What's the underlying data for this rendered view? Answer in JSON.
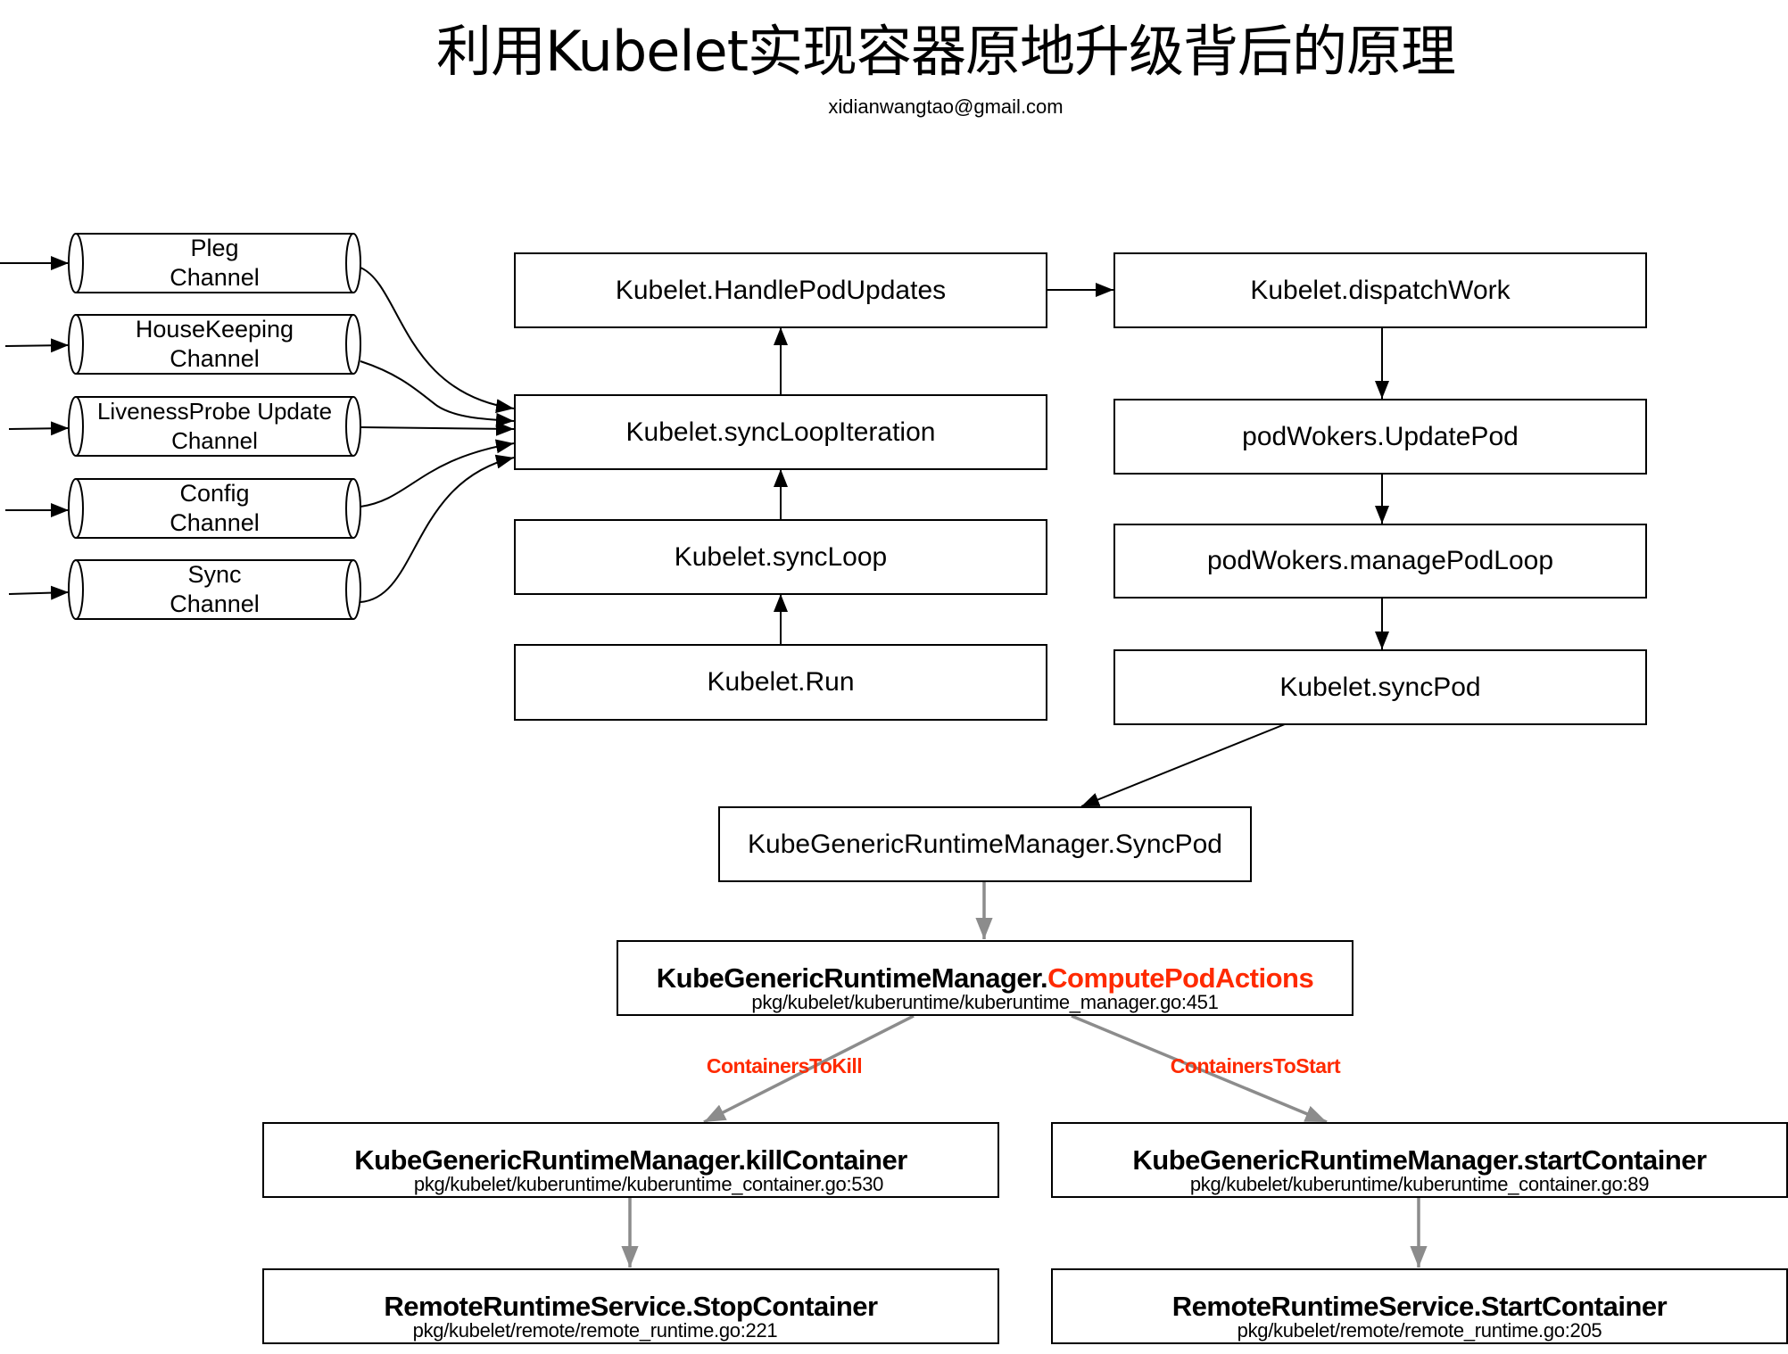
{
  "header": {
    "title": "利用Kubelet实现容器原地升级背后的原理",
    "author": "xidianwangtao@gmail.com"
  },
  "channels": [
    {
      "line1": "Pleg",
      "line2": "Channel"
    },
    {
      "line1": "HouseKeeping",
      "line2": "Channel"
    },
    {
      "line1": "LivenessProbe Update",
      "line2": "Channel"
    },
    {
      "line1": "Config",
      "line2": "Channel"
    },
    {
      "line1": "Sync",
      "line2": "Channel"
    }
  ],
  "kubelet_loop": {
    "handle_pod_updates": "Kubelet.HandlePodUpdates",
    "sync_loop_iteration": "Kubelet.syncLoopIteration",
    "sync_loop": "Kubelet.syncLoop",
    "run": "Kubelet.Run"
  },
  "pod_workers": {
    "dispatch_work": "Kubelet.dispatchWork",
    "update_pod": "podWokers.UpdatePod",
    "manage_pod_loop": "podWokers.managePodLoop",
    "sync_pod": "Kubelet.syncPod"
  },
  "runtime": {
    "sync_pod": "KubeGenericRuntimeManager.SyncPod",
    "compute_prefix": "KubeGenericRuntimeManager.",
    "compute_method": "ComputePodActions",
    "compute_path": "pkg/kubelet/kuberuntime/kuberuntime_manager.go:451",
    "kill_label": "ContainersToKill",
    "start_label": "ContainersToStart",
    "kill_container": "KubeGenericRuntimeManager.killContainer",
    "kill_container_path": "pkg/kubelet/kuberuntime/kuberuntime_container.go:530",
    "start_container": "KubeGenericRuntimeManager.startContainer",
    "start_container_path": "pkg/kubelet/kuberuntime/kuberuntime_container.go:89",
    "stop_remote": "RemoteRuntimeService.StopContainer",
    "stop_remote_path": "pkg/kubelet/remote/remote_runtime.go:221",
    "start_remote": "RemoteRuntimeService.StartContainer",
    "start_remote_path": "pkg/kubelet/remote/remote_runtime.go:205"
  },
  "colors": {
    "highlight": "#ff2a00",
    "gray_arrow": "#8c8c8c",
    "line": "#000000"
  }
}
